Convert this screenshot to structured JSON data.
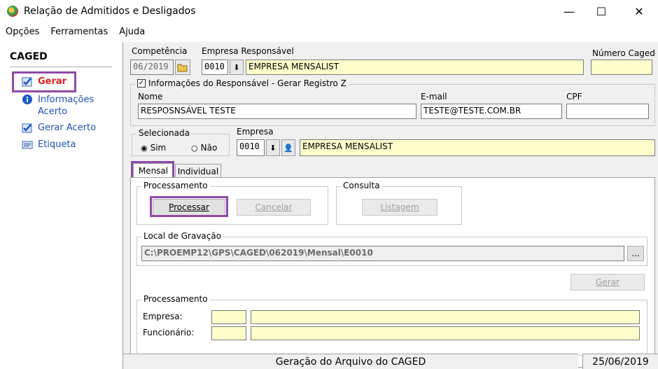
{
  "window": {
    "title": "Relação de Admitidos e Desligados",
    "minimize": "—",
    "maximize": "☐",
    "close": "✕"
  },
  "menu": [
    "Opções",
    "Ferramentas",
    "Ajuda"
  ],
  "sidebar": {
    "title": "CAGED",
    "items": [
      {
        "label": "Gerar",
        "icon": "check-document-icon"
      },
      {
        "label": "Informações Acerto",
        "icon": "info-icon"
      },
      {
        "label": "Gerar Acerto",
        "icon": "check-document-icon"
      },
      {
        "label": "Etiqueta",
        "icon": "label-icon"
      }
    ]
  },
  "form": {
    "competencia_label": "Competência",
    "competencia_value": "06/2019",
    "empresa_resp_label": "Empresa Responsável",
    "empresa_resp_code": "0010",
    "empresa_resp_name": "EMPRESA MENSALIST",
    "numero_caged_label": "Número Caged",
    "numero_caged_value": "",
    "info_resp_label": "Informações do Responsável - Gerar Registro Z",
    "nome_label": "Nome",
    "nome_value": "RESPOSNSÁVEL TESTE",
    "email_label": "E-mail",
    "email_value": "TESTE@TESTE.COM.BR",
    "cpf_label": "CPF",
    "cpf_value": "",
    "selecionada_label": "Selecionada",
    "sim_label": "Sim",
    "nao_label": "Não",
    "empresa_label": "Empresa",
    "empresa_code": "0010",
    "empresa_name": "EMPRESA MENSALIST"
  },
  "tabs": [
    "Mensal",
    "Individual"
  ],
  "processamento": {
    "title": "Processamento",
    "processar": "Processar",
    "cancelar": "Cancelar"
  },
  "consulta": {
    "title": "Consulta",
    "listagem": "Listagem"
  },
  "gravacao": {
    "title": "Local de Gravação",
    "path": "C:\\PROEMP12\\GPS\\CAGED\\062019\\Mensal\\E0010",
    "browse": "..."
  },
  "gerar_button": "Gerar",
  "processamento2": {
    "title": "Processamento",
    "empresa_label": "Empresa:",
    "funcionario_label": "Funcionário:"
  },
  "status": {
    "text": "Geração do Arquivo do CAGED",
    "date": "25/06/2019"
  }
}
